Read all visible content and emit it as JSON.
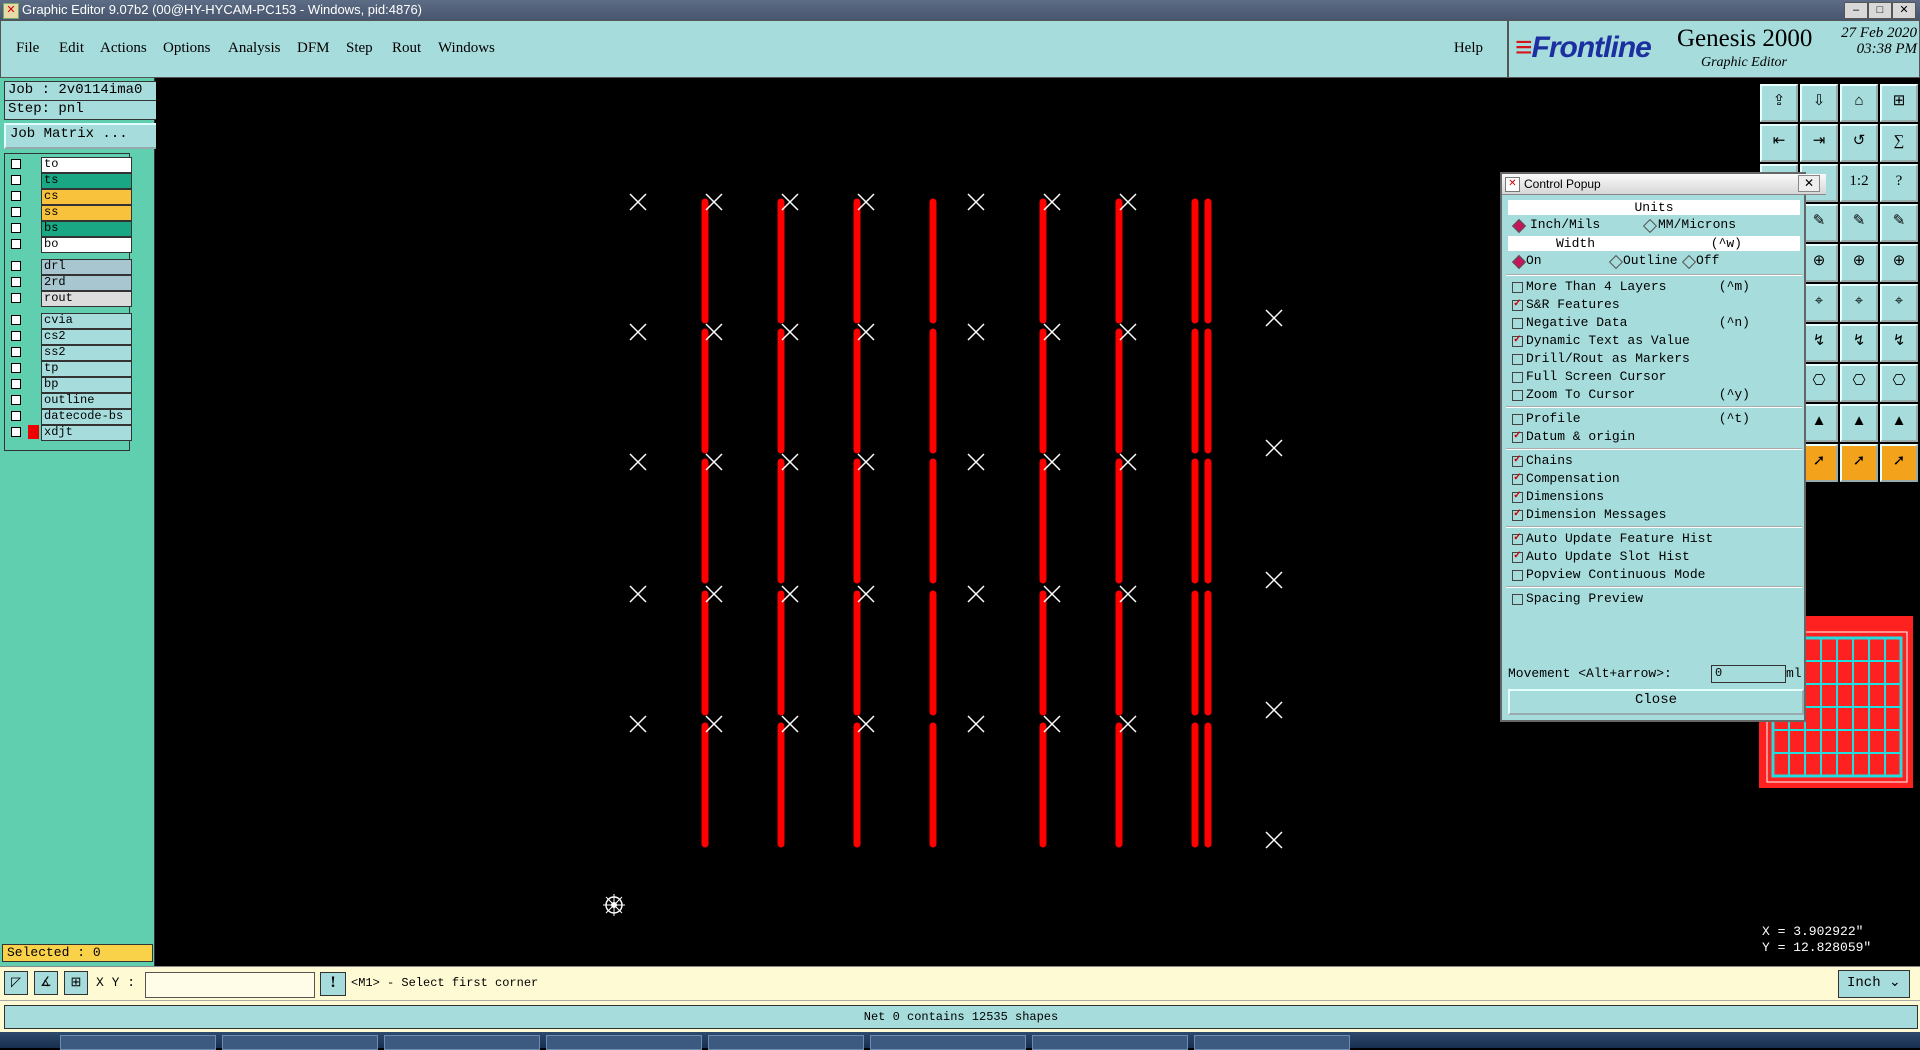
{
  "window": {
    "title": "Graphic Editor 9.07b2 (00@HY-HYCAM-PC153 - Windows, pid:4876)"
  },
  "menu": {
    "items": [
      "File",
      "Edit",
      "Actions",
      "Options",
      "Analysis",
      "DFM",
      "Step",
      "Rout",
      "Windows"
    ],
    "help": "Help"
  },
  "brand": {
    "logo": "Frontline",
    "product": "Genesis 2000",
    "subtitle": "Graphic Editor",
    "date": "27 Feb 2020",
    "time": "03:38 PM"
  },
  "job": {
    "job_label": "Job : 2v0114ima0",
    "step_label": "Step: pnl",
    "matrix_button": "Job Matrix ..."
  },
  "layers": [
    {
      "name": "to",
      "color": "#ffffff"
    },
    {
      "name": "ts",
      "color": "#1aa884"
    },
    {
      "name": "cs",
      "color": "#f9c23c"
    },
    {
      "name": "ss",
      "color": "#f9c23c"
    },
    {
      "name": "bs",
      "color": "#1aa884"
    },
    {
      "name": "bo",
      "color": "#ffffff"
    },
    {
      "name": "drl",
      "color": "#a7c6cf"
    },
    {
      "name": "2rd",
      "color": "#a7c6cf"
    },
    {
      "name": "rout",
      "color": "#dcdcdc"
    },
    {
      "name": "cvia",
      "color": "#a7dcdc"
    },
    {
      "name": "cs2",
      "color": "#a7dcdc"
    },
    {
      "name": "ss2",
      "color": "#a7dcdc"
    },
    {
      "name": "tp",
      "color": "#a7dcdc"
    },
    {
      "name": "bp",
      "color": "#a7dcdc"
    },
    {
      "name": "outline",
      "color": "#a7dcdc"
    },
    {
      "name": "datecode-bs",
      "color": "#a7dcdc"
    },
    {
      "name": "xdjt",
      "color": "#a7dcdc"
    }
  ],
  "selected": "Selected : 0",
  "popup": {
    "title": "Control Popup",
    "units_header": "Units",
    "units_options": [
      "Inch/Mils",
      "MM/Microns"
    ],
    "width_header": "Width",
    "width_shortcut": "(^w)",
    "width_options": [
      "On",
      "Outline",
      "Off"
    ],
    "groups": [
      [
        {
          "label": "More Than 4 Layers",
          "shortcut": "(^m)",
          "checked": false
        },
        {
          "label": "S&R Features",
          "shortcut": "",
          "checked": true
        },
        {
          "label": "Negative Data",
          "shortcut": "(^n)",
          "checked": false
        },
        {
          "label": "Dynamic Text as Value",
          "shortcut": "",
          "checked": true
        },
        {
          "label": "Drill/Rout as Markers",
          "shortcut": "",
          "checked": false
        },
        {
          "label": "Full Screen Cursor",
          "shortcut": "",
          "checked": false
        },
        {
          "label": "Zoom To Cursor",
          "shortcut": "(^y)",
          "checked": false
        }
      ],
      [
        {
          "label": "Profile",
          "shortcut": "(^t)",
          "checked": false
        },
        {
          "label": "Datum & origin",
          "shortcut": "",
          "checked": true
        }
      ],
      [
        {
          "label": "Chains",
          "shortcut": "",
          "checked": true
        },
        {
          "label": "Compensation",
          "shortcut": "",
          "checked": true
        },
        {
          "label": "Dimensions",
          "shortcut": "",
          "checked": true
        },
        {
          "label": "Dimension Messages",
          "shortcut": "",
          "checked": true
        }
      ],
      [
        {
          "label": "Auto Update Feature Hist",
          "shortcut": "",
          "checked": true
        },
        {
          "label": "Auto Update Slot Hist",
          "shortcut": "",
          "checked": true
        },
        {
          "label": "Popview Continuous Mode",
          "shortcut": "",
          "checked": false
        }
      ],
      [
        {
          "label": "Spacing Preview",
          "shortcut": "",
          "checked": false
        }
      ]
    ],
    "movement_label": "Movement <Alt+arrow>:",
    "movement_value": "0",
    "movement_unit": "ml",
    "close_label": "Close"
  },
  "coords": {
    "x": "X = 3.902922\"",
    "y": "Y = 12.828059\""
  },
  "bottombar": {
    "xy_label": "X Y :",
    "xy_value": "",
    "prompt": "<M1> - Select first corner",
    "units": "Inch"
  },
  "status": "Net 0 contains 12535 shapes",
  "toolbar_glyphs": [
    "⇪",
    "⇩",
    "⌂",
    "⊞",
    "⇤",
    "⇥",
    "↺",
    "∑",
    "◧",
    "◫",
    "1:2",
    "?"
  ],
  "colors": {
    "panel": "#a7dcdc",
    "left_panel": "#5fcfaf",
    "feature": "#ff0000",
    "marker": "#ffffff",
    "background": "#000000"
  }
}
